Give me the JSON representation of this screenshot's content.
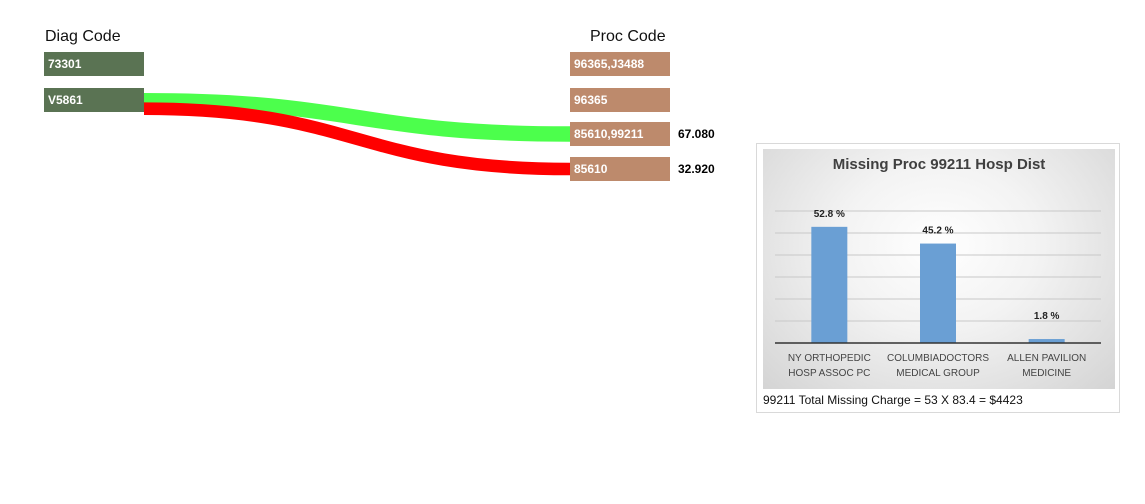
{
  "sankey": {
    "diag_header": "Diag Code",
    "proc_header": "Proc Code",
    "diag_nodes": [
      "73301",
      "V5861"
    ],
    "proc_nodes": [
      "96365,J3488",
      "96365",
      "85610,99211",
      "85610"
    ],
    "flows": [
      {
        "from": "V5861",
        "to": "85610,99211",
        "value": 67.08,
        "label": "67.080",
        "color": "#4cff4c"
      },
      {
        "from": "V5861",
        "to": "85610",
        "value": 32.92,
        "label": "32.920",
        "color": "#ff0000"
      }
    ],
    "colors": {
      "diag_node": "#5a7353",
      "proc_node": "#bd8a6c"
    }
  },
  "chart_data": {
    "type": "bar",
    "title": "Missing Proc 99211 Hosp Dist",
    "categories": [
      [
        "NY ORTHOPEDIC",
        "HOSP ASSOC PC"
      ],
      [
        "COLUMBIADOCTORS",
        "MEDICAL GROUP"
      ],
      [
        "ALLEN PAVILION",
        "MEDICINE"
      ]
    ],
    "values": [
      52.8,
      45.2,
      1.8
    ],
    "data_labels": [
      "52.8 %",
      "45.2 %",
      "1.8 %"
    ],
    "ylim": [
      0,
      60
    ],
    "grid": true,
    "bar_color": "#6a9fd4"
  },
  "caption": "99211 Total Missing Charge = 53 X 83.4 = $4423"
}
